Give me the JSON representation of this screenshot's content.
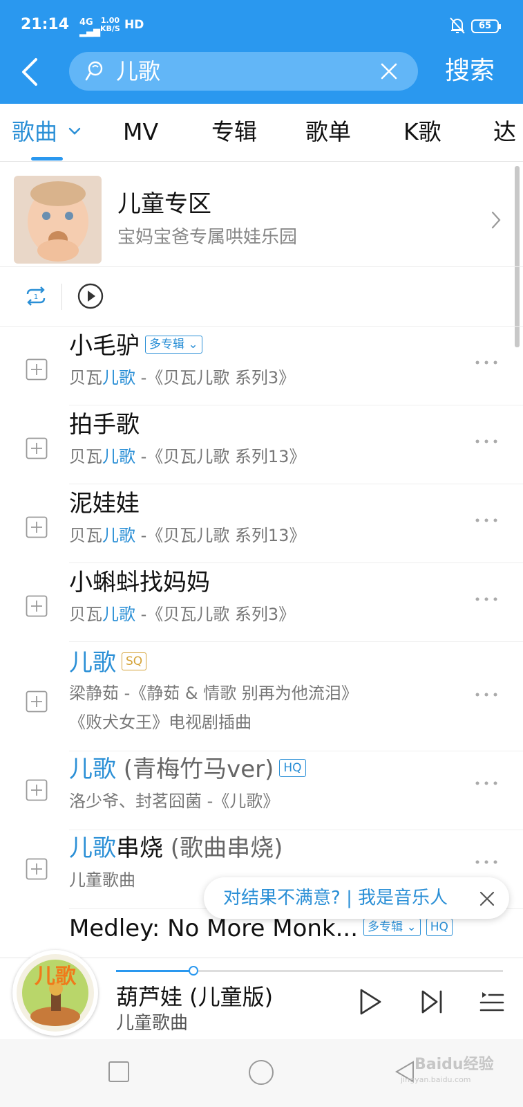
{
  "status_bar": {
    "time": "21:14",
    "network": "4G",
    "speed_value": "1.00",
    "speed_unit": "KB/S",
    "hd": "HD",
    "battery": "65"
  },
  "search": {
    "query": "儿歌",
    "button": "搜索"
  },
  "tabs": [
    {
      "label": "歌曲"
    },
    {
      "label": "MV"
    },
    {
      "label": "专辑"
    },
    {
      "label": "歌单"
    },
    {
      "label": "K歌"
    },
    {
      "label": "达"
    }
  ],
  "zone": {
    "title": "儿童专区",
    "subtitle": "宝妈宝爸专属哄娃乐园"
  },
  "songs": [
    {
      "title": "小毛驴",
      "badge": "多专辑",
      "artist_prefix": "贝瓦",
      "artist_hl": "儿歌",
      "album": " -《贝瓦儿歌 系列3》"
    },
    {
      "title": "拍手歌",
      "artist_prefix": "贝瓦",
      "artist_hl": "儿歌",
      "album": " -《贝瓦儿歌 系列13》"
    },
    {
      "title": "泥娃娃",
      "artist_prefix": "贝瓦",
      "artist_hl": "儿歌",
      "album": " -《贝瓦儿歌 系列13》"
    },
    {
      "title": "小蝌蚪找妈妈",
      "artist_prefix": "贝瓦",
      "artist_hl": "儿歌",
      "album": " -《贝瓦儿歌 系列3》"
    },
    {
      "title_hl": "儿歌",
      "badge": "SQ",
      "meta": "梁静茹 -《静茹 & 情歌 别再为他流泪》",
      "meta2": "《败犬女王》电视剧插曲"
    },
    {
      "title_hl": "儿歌",
      "title_rest": " (青梅竹马ver)",
      "badge": "HQ",
      "meta": "洛少爷、封茗囧菌 -《儿歌》"
    },
    {
      "title_hl": "儿歌",
      "title_rest": "串烧",
      "title_grey": " (歌曲串烧)",
      "meta": "儿童歌曲"
    },
    {
      "title": "Medley: No More Monk...",
      "badge": "多专辑",
      "badge2": "HQ"
    }
  ],
  "toast": {
    "text": "对结果不满意? | 我是音乐人"
  },
  "player": {
    "title": "葫芦娃 (儿童版)",
    "artist": "儿童歌曲",
    "progress": 0.2,
    "cover_text": "儿歌"
  },
  "watermark": {
    "text": "Baidu经验",
    "url": "jingyan.baidu.com"
  },
  "colors": {
    "brand": "#2a98ef",
    "highlight": "#2a8fd6",
    "sq_badge": "#d4a236"
  }
}
